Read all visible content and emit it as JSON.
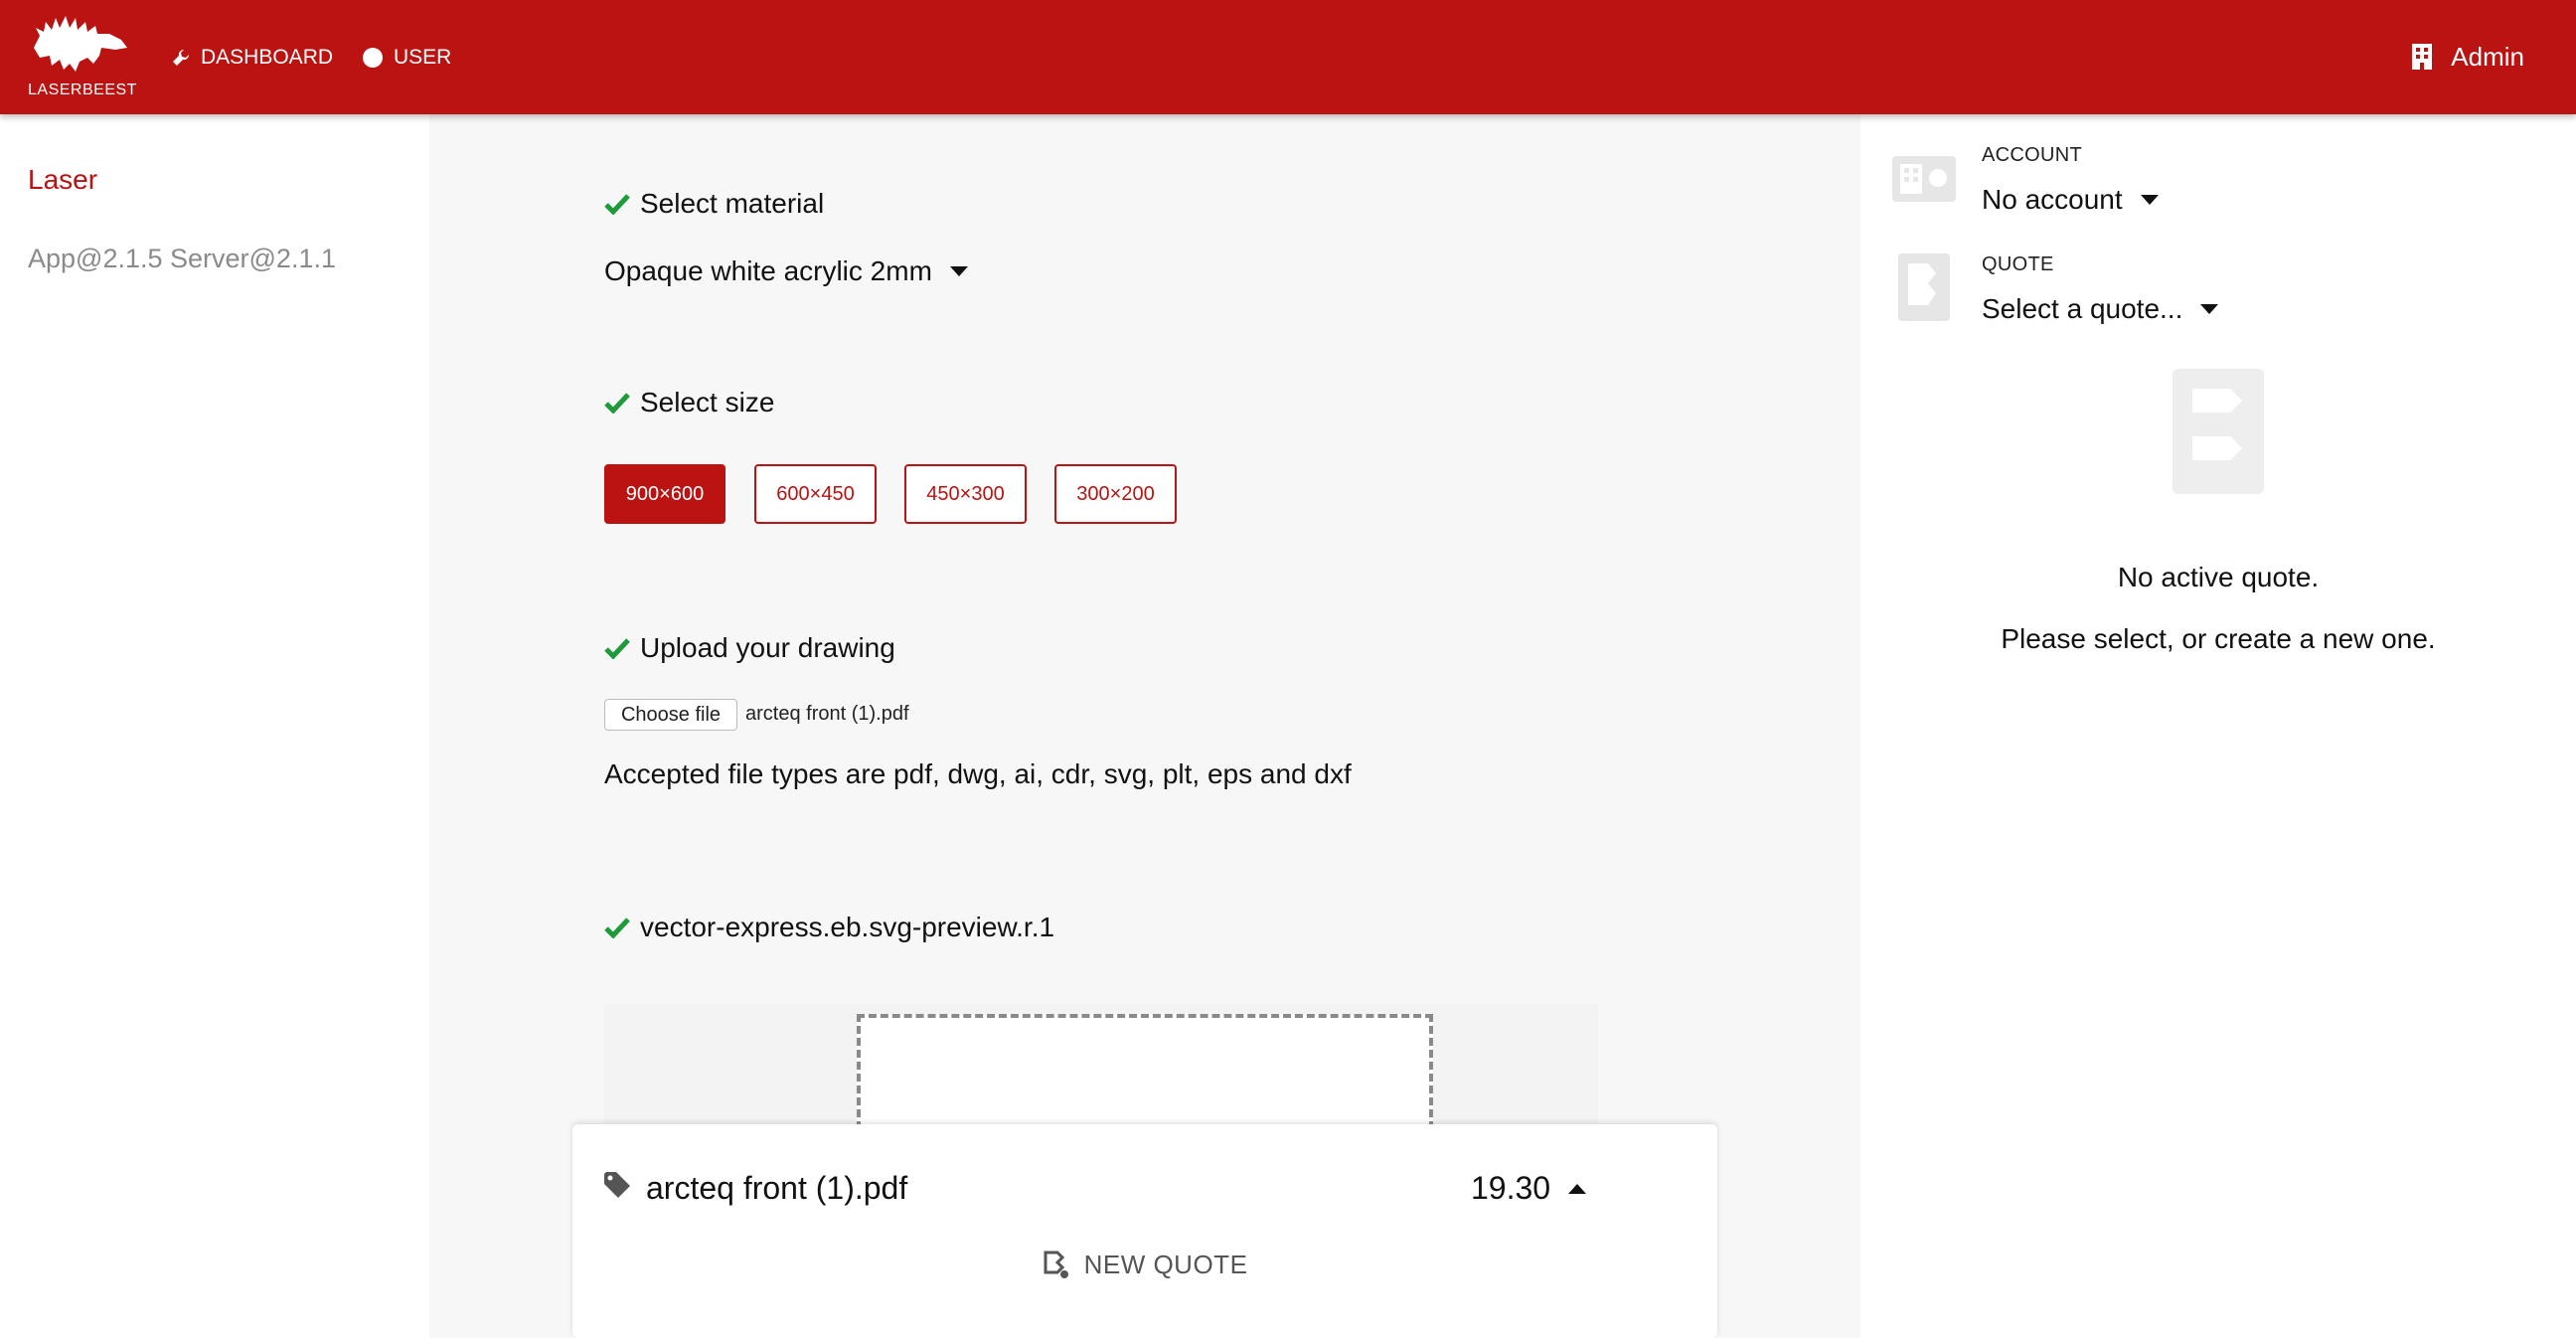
{
  "header": {
    "logo_text": "LASERBEEST",
    "nav": [
      {
        "label": "DASHBOARD",
        "icon": "wrench-icon"
      },
      {
        "label": "USER",
        "icon": "circle-icon"
      }
    ],
    "admin_label": "Admin",
    "colors": {
      "brand": "#bb1212"
    }
  },
  "sidebar": {
    "active_item": "Laser",
    "version": "App@2.1.5 Server@2.1.1"
  },
  "main": {
    "steps": {
      "material": {
        "title": "Select material",
        "selected": "Opaque white acrylic 2mm"
      },
      "size": {
        "title": "Select size",
        "options": [
          "900×600",
          "600×450",
          "450×300",
          "300×200"
        ],
        "selected": "900×600"
      },
      "upload": {
        "title": "Upload your drawing",
        "button_label": "Choose file",
        "file_name": "arcteq front (1).pdf",
        "accepted": "Accepted file types are pdf, dwg, ai, cdr, svg, plt, eps and dxf"
      },
      "preview": {
        "title": "vector-express.eb.svg-preview.r.1"
      }
    },
    "quote_card": {
      "file": "arcteq front (1).pdf",
      "price": "19.30",
      "new_quote_label": "NEW QUOTE"
    }
  },
  "right_panel": {
    "account": {
      "label": "ACCOUNT",
      "value": "No account"
    },
    "quote": {
      "label": "QUOTE",
      "value": "Select a quote..."
    },
    "empty_title": "No active quote.",
    "empty_text": "Please select, or create a new one."
  }
}
